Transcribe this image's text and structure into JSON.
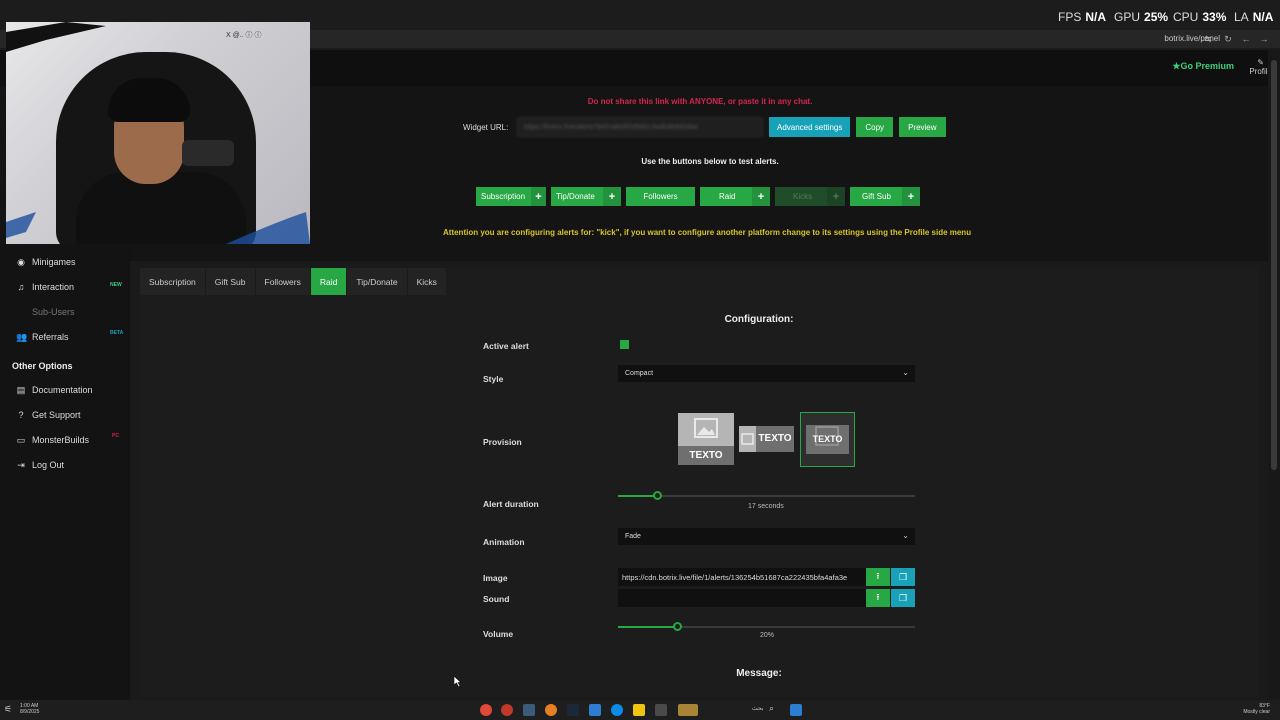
{
  "perf": {
    "fps_label": "FPS",
    "fps_value": "N/A",
    "gpu_label": "GPU",
    "gpu_value": "25%",
    "cpu_label": "CPU",
    "cpu_value": "33%",
    "lat_label": "LA",
    "lat_value": "N/A"
  },
  "browser": {
    "url": "botrix.live/panel"
  },
  "header": {
    "premium_label": "Go Premium",
    "profile_label": "Profile"
  },
  "widget": {
    "warning": "Do not share this link with ANYONE, or paste it in any chat.",
    "url_label": "Widget URL:",
    "url_value": "https://botrix.live/alerts?bid=a8d3f2d9d2c3a4b9b9d2dae",
    "advanced_label": "Advanced settings",
    "copy_label": "Copy",
    "preview_label": "Preview",
    "test_label": "Use the buttons below to test alerts.",
    "test_buttons": [
      "Subscription",
      "Tip/Donate",
      "Followers",
      "Raid",
      "Kicks",
      "Gift Sub"
    ],
    "attention": "Attention you are configuring alerts for: \"kick\", if you want to configure another platform change to its settings using the Profile side menu"
  },
  "webcam": {
    "socials": "X @.. ⓘ ⓘ"
  },
  "sidebar": {
    "items": [
      {
        "label": "Minigames",
        "icon": "gamepad-icon"
      },
      {
        "label": "Interaction",
        "icon": "music-icon",
        "badge": "NEW"
      },
      {
        "label": "Sub-Users",
        "icon": ""
      },
      {
        "label": "Referrals",
        "icon": "users-icon",
        "badge": "BETA"
      }
    ],
    "other_heading": "Other Options",
    "other_items": [
      {
        "label": "Documentation",
        "icon": "book-icon"
      },
      {
        "label": "Get Support",
        "icon": "help-icon"
      },
      {
        "label": "MonsterBuilds",
        "icon": "laptop-icon",
        "badge": "PC"
      },
      {
        "label": "Log Out",
        "icon": "logout-icon"
      }
    ]
  },
  "tabs": [
    "Subscription",
    "Gift Sub",
    "Followers",
    "Raid",
    "Tip/Donate",
    "Kicks"
  ],
  "active_tab": "Raid",
  "config": {
    "title": "Configuration:",
    "active_alert_label": "Active alert",
    "active_alert_checked": true,
    "style_label": "Style",
    "style_value": "Compact",
    "provision_label": "Provision",
    "provision_text": "TEXTO",
    "provision_selected": 2,
    "duration_label": "Alert duration",
    "duration_caption": "17 seconds",
    "duration_fraction": 0.13,
    "animation_label": "Animation",
    "animation_value": "Fade",
    "image_label": "Image",
    "image_value": "https://cdn.botrix.live/file/1/alerts/136254b51687ca222435bfa4afa3e",
    "sound_label": "Sound",
    "sound_value": "",
    "volume_label": "Volume",
    "volume_caption": "20%",
    "volume_fraction": 0.2,
    "message_title": "Message:"
  },
  "taskbar": {
    "time": "1:00 AM",
    "date": "8/9/2025",
    "search": "بحث",
    "weather_temp": "83°F",
    "weather_desc": "Mostly clear"
  },
  "colors": {
    "green": "#28a745",
    "teal": "#17a2b8",
    "warning": "#d5254e",
    "attention": "#d8c32d",
    "premium": "#3ecf7a"
  }
}
